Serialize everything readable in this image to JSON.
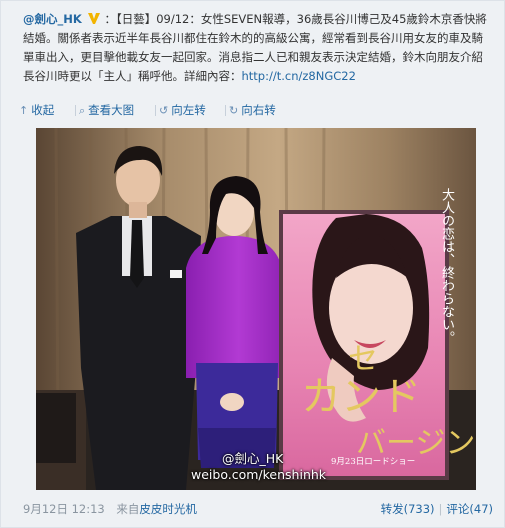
{
  "post": {
    "author": "@劍心_HK",
    "lead": "：【日藝】09/12：女性SEVEN報導，36歲長谷川博己及45歲鈴木京香快將結婚。關係者表示近半年長谷川都住在鈴木的的高級公寓，經常看到長谷川用女友的車及騎單車出入，更目擊他載女友一起回家。消息指二人已和親友表示決定結婚，鈴木向朋友介紹長谷川時更以「主人」稱呼他。詳細內容：",
    "link": "http://t.cn/z8NGC22"
  },
  "toolbar": {
    "collapse": "收起",
    "view_large": "查看大图",
    "rotate_left": "向左转",
    "rotate_right": "向右转"
  },
  "watermark": {
    "line1": "@劍心_HK",
    "line2": "weibo.com/kenshinhk"
  },
  "poster": {
    "tagline": "大人の恋は、終わらない。",
    "title_1": "セ",
    "title_2": "カンド",
    "title_3": "バージン",
    "date": "9月23日ロードショー"
  },
  "footer": {
    "time": "9月12日 12:13",
    "source_prefix": "来自",
    "source": "皮皮时光机",
    "repost": "转发(733)",
    "comment": "评论(47)"
  },
  "colors": {
    "link": "#2468a2",
    "bg": "#eef1f4",
    "badge": "#f2b400"
  },
  "icons": [
    "v-badge-icon",
    "collapse-icon",
    "zoom-icon",
    "rotate-left-icon",
    "rotate-right-icon"
  ]
}
